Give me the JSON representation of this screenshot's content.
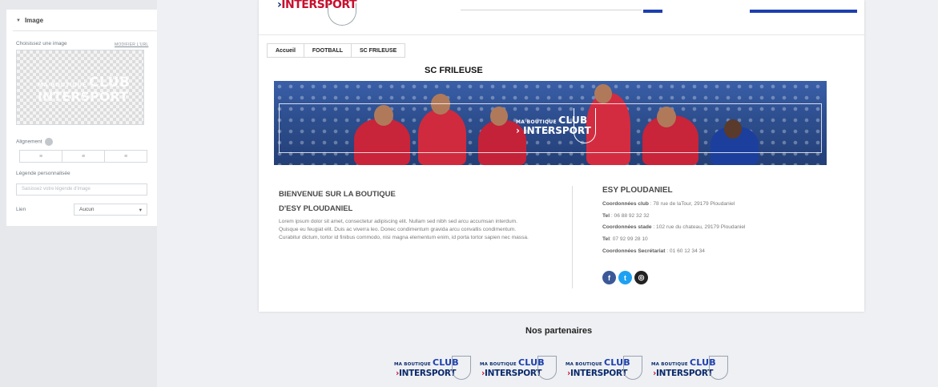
{
  "editor": {
    "section_title": "Image",
    "choose_image_label": "Choisissez une image",
    "modify_url_link": "MODIFIER L'URL",
    "preview_logo": {
      "line1_small": "MA BOUTIQUE",
      "line1_big": "CLUB",
      "line2": "INTERSPORT"
    },
    "alignment_label": "Alignement",
    "alignment_options": [
      "left",
      "center",
      "right"
    ],
    "custom_caption_label": "Légende personnalisée",
    "caption_placeholder": "Saisissez votre légende d'image",
    "link_label": "Lien",
    "link_value": "Aucun"
  },
  "site": {
    "header_logo": {
      "arrow": "›",
      "brand": "INTERSPORT"
    },
    "breadcrumb": [
      "Accueil",
      "FOOTBALL",
      "SC FRILEUSE"
    ],
    "page_title": "SC FRILEUSE",
    "banner_logo": {
      "small": "MA BOUTIQUE",
      "big": "CLUB",
      "brand": "INTERSPORT"
    },
    "welcome_line1": "BIENVENUE SUR LA BOUTIQUE",
    "welcome_line2": "D'ESY PLOUDANIEL",
    "lorem": "Lorem ipsum dolor sit amet, consectetur adipiscing elit. Nullam sed nibh sed arcu accumsan interdum. Quisque eu feugiat elit. Duis ac viverra leo. Donec condimentum gravida arcu convallis condimentum. Curabitur dictum, tortor id finibus commodo, nisi magna elementum enim, id porta tortor sapien nec massa.",
    "club_name": "ESY PLOUDANIEL",
    "info": [
      {
        "label": "Coordonnées club",
        "value": " : 78 rue de laTour, 29179 Ploudaniel"
      },
      {
        "label": "Tel",
        "value": " : 06 88 92 32 32"
      },
      {
        "label": "Coordonnées stade",
        "value": " : 102 rue du chateau, 29179 Ploudaniel"
      },
      {
        "label": "Tel",
        "value": ": 07 92 99 28 10"
      },
      {
        "label": "Coordonnées Secrétariat",
        "value": " : 01 60 12 34 34"
      }
    ],
    "social": [
      {
        "name": "facebook",
        "glyph": "f"
      },
      {
        "name": "twitter",
        "glyph": "t"
      },
      {
        "name": "instagram",
        "glyph": "◎"
      }
    ],
    "partners_title": "Nos partenaires",
    "partner_logo": {
      "small": "MA BOUTIQUE",
      "big": "CLUB",
      "brand": "INTERSPORT"
    }
  },
  "colors": {
    "intersport_blue": "#0a2a6b",
    "intersport_red": "#c8102e",
    "accent_blue": "#1c3fae",
    "banner_blue": "#2d4e8e"
  }
}
